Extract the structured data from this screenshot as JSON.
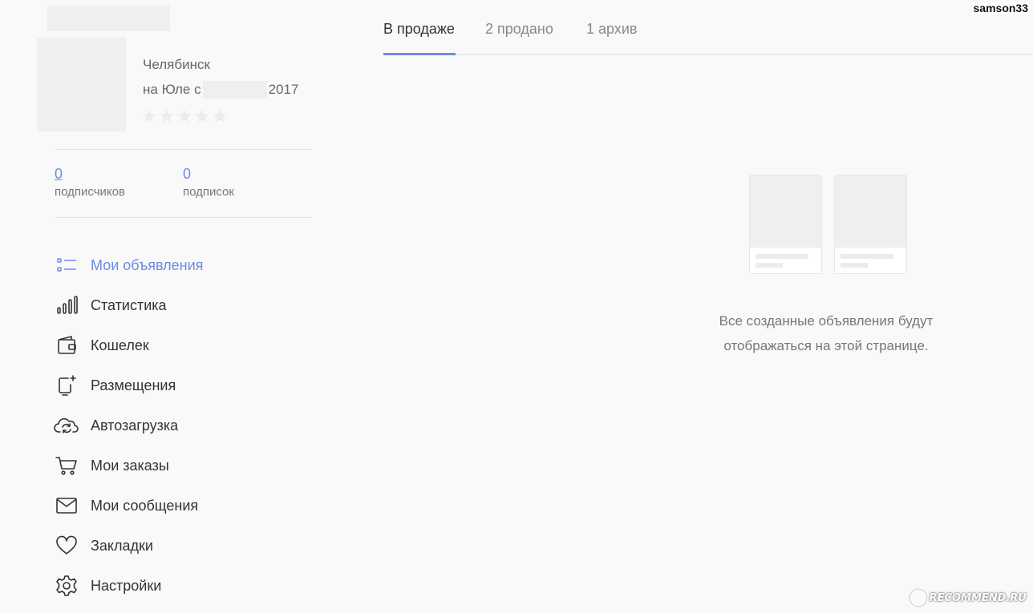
{
  "watermark_user": "samson33",
  "profile": {
    "city": "Челябинск",
    "since_prefix": "на Юле с",
    "since_year": "2017",
    "rating_stars": 0,
    "rating_max": 5
  },
  "counters": [
    {
      "value": "0",
      "label": "подписчиков"
    },
    {
      "value": "0",
      "label": "подписок"
    }
  ],
  "menu": [
    {
      "label": "Мои объявления",
      "icon": "list-icon",
      "active": true
    },
    {
      "label": "Статистика",
      "icon": "bar-chart-icon"
    },
    {
      "label": "Кошелек",
      "icon": "wallet-icon"
    },
    {
      "label": "Размещения",
      "icon": "placement-icon"
    },
    {
      "label": "Автозагрузка",
      "icon": "cloud-sync-icon"
    },
    {
      "label": "Мои заказы",
      "icon": "cart-icon"
    },
    {
      "label": "Мои сообщения",
      "icon": "envelope-icon"
    },
    {
      "label": "Закладки",
      "icon": "heart-icon"
    },
    {
      "label": "Настройки",
      "icon": "gear-icon"
    }
  ],
  "tabs": [
    {
      "label": "В продаже",
      "active": true
    },
    {
      "label": "2 продано"
    },
    {
      "label": "1 архив"
    }
  ],
  "empty_state": {
    "line1": "Все созданные объявления будут",
    "line2": "отображаться на этой странице."
  },
  "logo_text": "RECOMMEND.RU",
  "colors": {
    "accent": "#6f8ae6",
    "text": "#333333",
    "muted": "#777777",
    "background": "#f9f9f9"
  }
}
